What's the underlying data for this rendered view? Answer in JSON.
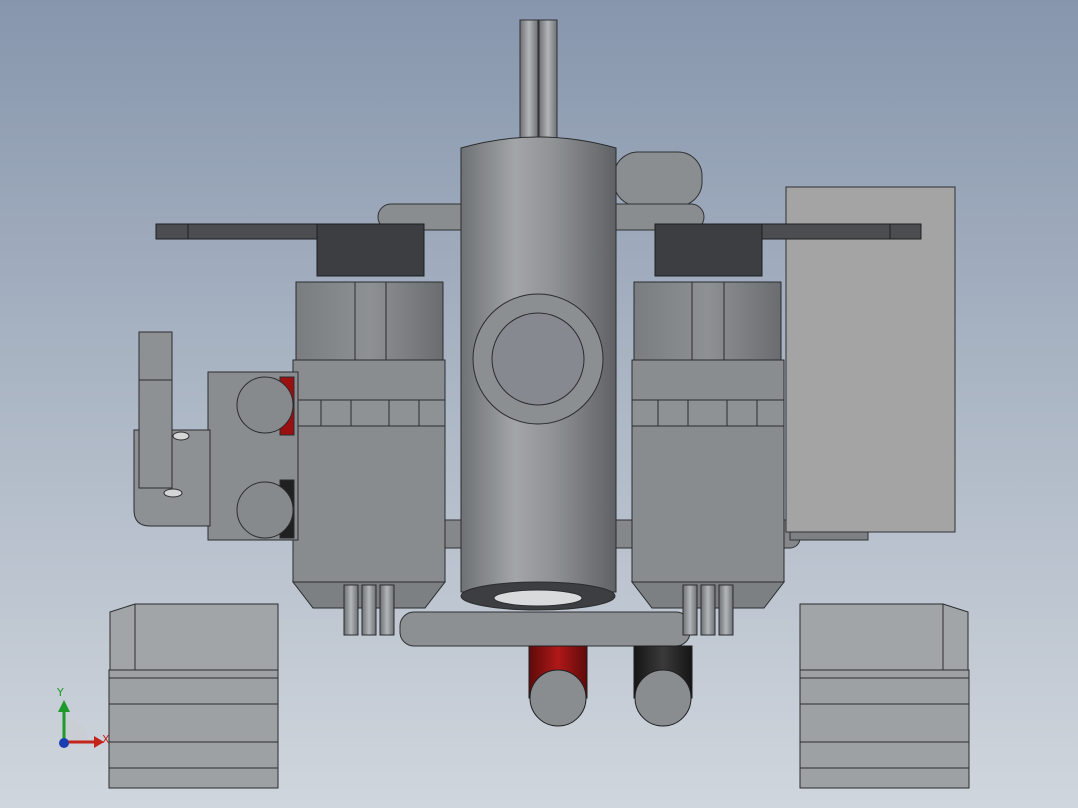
{
  "viewport": {
    "background_top": "#8796ad",
    "background_bottom": "#d0d6dd"
  },
  "model": {
    "body_color": "#8c8f92",
    "dark_part_color": "#3c3e41",
    "light_panel_color": "#a4a4a4",
    "red_tube_color": "#9a0f0f",
    "black_tube_color": "#202020"
  },
  "triad": {
    "y_label": "Y",
    "x_label": "X",
    "y_color": "#1d9a2a",
    "x_color": "#c6241b",
    "origin_color": "#1a3fb0"
  }
}
